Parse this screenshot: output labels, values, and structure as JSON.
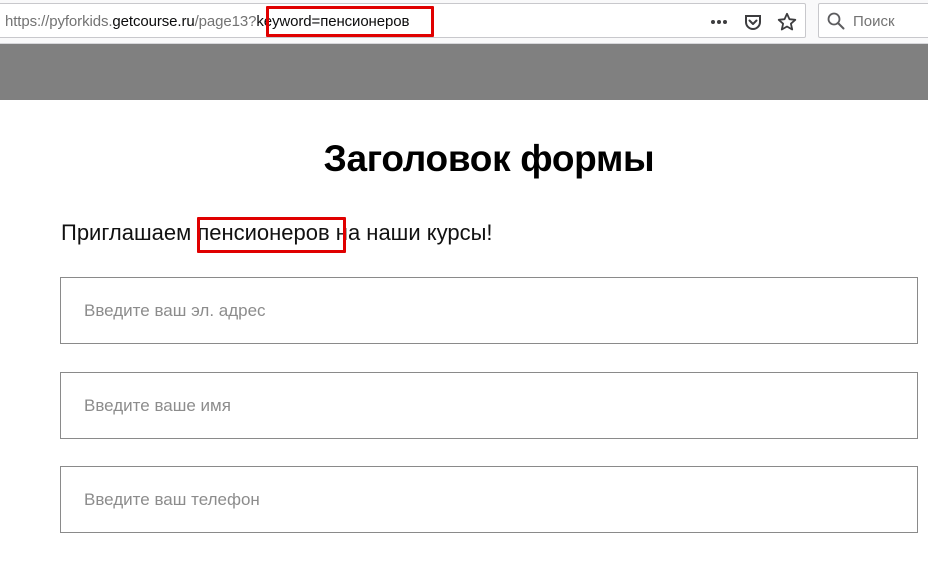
{
  "browser": {
    "url_base": "https://pyforkids.",
    "url_domain": "getcourse.ru",
    "url_path": "/page13?",
    "url_keyword": "keyword=пенсионеров",
    "search_placeholder": "Поиск"
  },
  "form": {
    "title": "Заголовок формы",
    "invite_before": "Приглашаем ",
    "invite_keyword": "пенсионеров",
    "invite_after": " на наши курсы!",
    "fields": [
      {
        "placeholder": "Введите ваш эл. адрес",
        "value": ""
      },
      {
        "placeholder": "Введите ваше имя",
        "value": ""
      },
      {
        "placeholder": "Введите ваш телефон",
        "value": ""
      }
    ]
  },
  "colors": {
    "highlight": "#e00000",
    "header_band": "#808080"
  }
}
